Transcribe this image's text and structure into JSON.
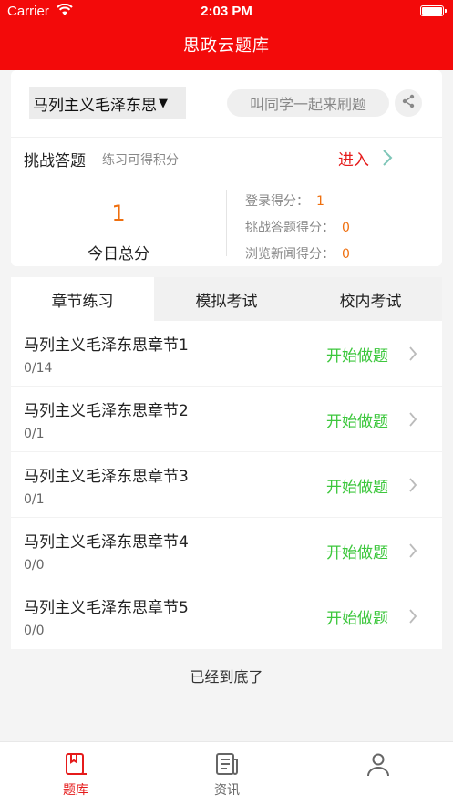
{
  "status_bar": {
    "carrier": "Carrier",
    "time": "2:03 PM"
  },
  "header": {
    "title": "思政云题库"
  },
  "subject": {
    "selected": "马列主义毛泽东思",
    "arrow": "▼"
  },
  "invite": {
    "label": "叫同学一起来刷题"
  },
  "challenge": {
    "title": "挑战答题",
    "subtitle": "练习可得积分",
    "enter_label": "进入"
  },
  "today": {
    "total": "1",
    "total_label": "今日总分"
  },
  "scores": [
    {
      "label": "登录得分：",
      "value": "1"
    },
    {
      "label": "挑战答题得分：",
      "value": "0"
    },
    {
      "label": "浏览新闻得分：",
      "value": "0"
    }
  ],
  "tabs": [
    {
      "label": "章节练习",
      "active": true
    },
    {
      "label": "模拟考试",
      "active": false
    },
    {
      "label": "校内考试",
      "active": false
    }
  ],
  "chapters": [
    {
      "title": "马列主义毛泽东思章节1",
      "progress": "0/14",
      "action": "开始做题"
    },
    {
      "title": "马列主义毛泽东思章节2",
      "progress": "0/1",
      "action": "开始做题"
    },
    {
      "title": "马列主义毛泽东思章节3",
      "progress": "0/1",
      "action": "开始做题"
    },
    {
      "title": "马列主义毛泽东思章节4",
      "progress": "0/0",
      "action": "开始做题"
    },
    {
      "title": "马列主义毛泽东思章节5",
      "progress": "0/0",
      "action": "开始做题"
    }
  ],
  "list_end": "已经到底了",
  "tabbar": [
    {
      "label": "题库",
      "icon": "question-bank-icon",
      "active": true
    },
    {
      "label": "资讯",
      "icon": "news-icon",
      "active": false
    },
    {
      "label": "",
      "icon": "profile-icon",
      "active": false
    }
  ],
  "colors": {
    "brand_red": "#f30a0a",
    "accent_orange": "#ef6f0e",
    "action_green": "#3dc73d"
  }
}
